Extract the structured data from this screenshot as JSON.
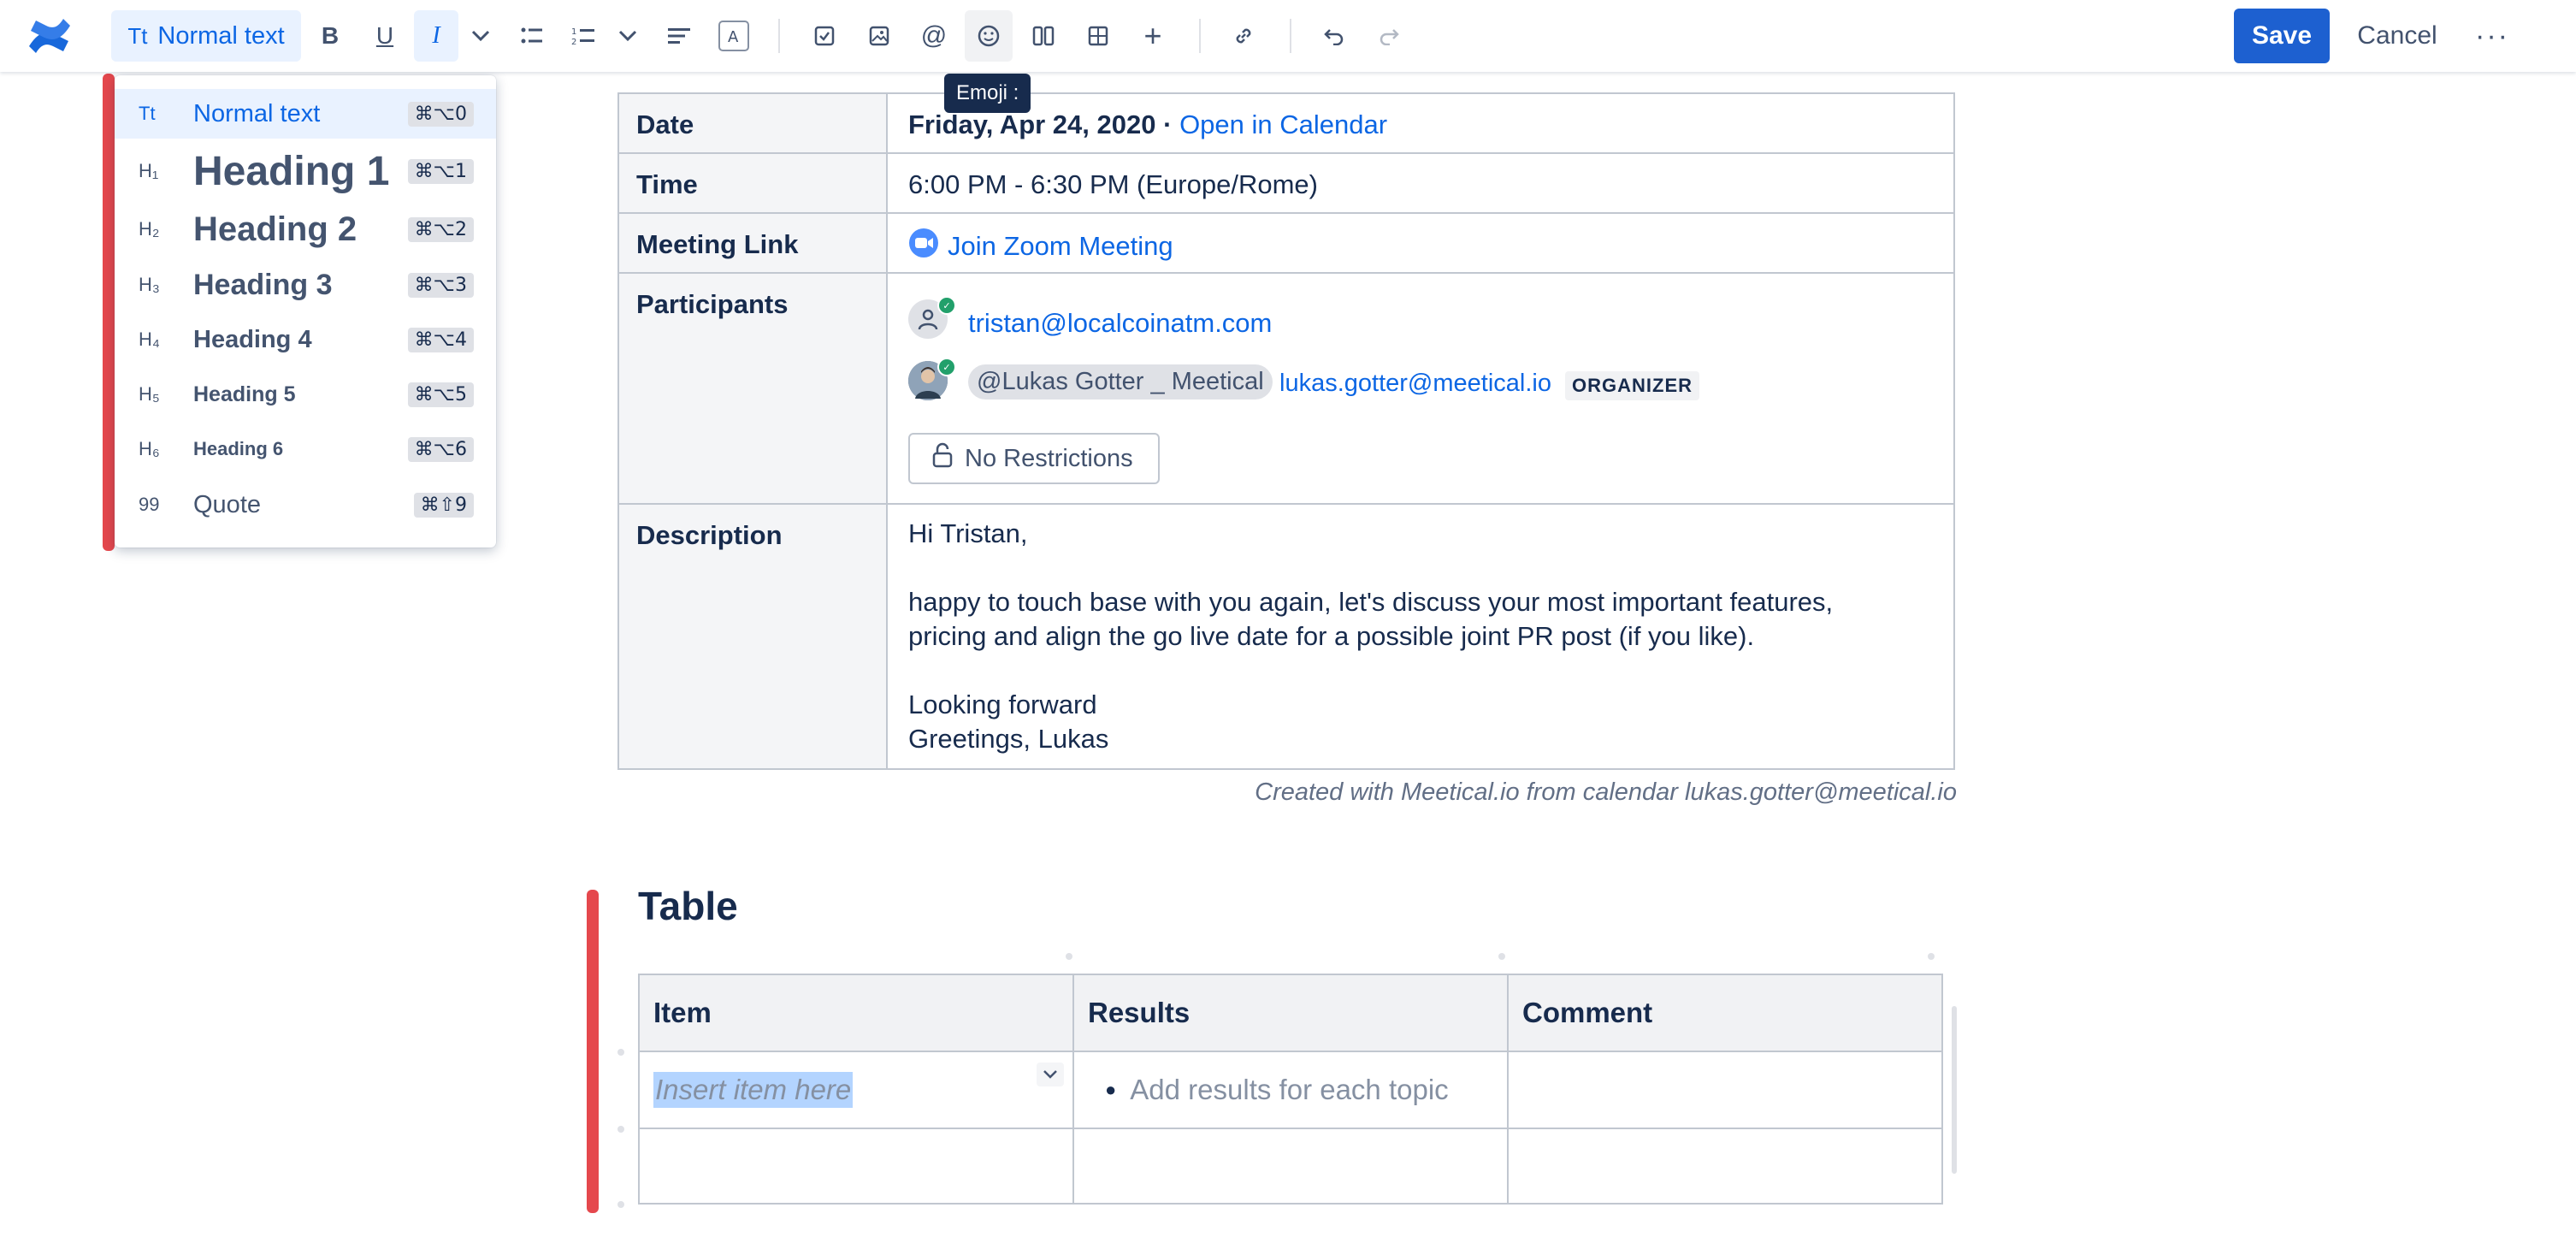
{
  "toolbar": {
    "text_style_label": "Normal text",
    "text_style_icon": "Tt",
    "buttons": [
      "bold-icon",
      "underline-icon",
      "italic-icon",
      "more-formatting-icon",
      "bullet-list-icon",
      "numbered-list-icon",
      "list-dropdown-icon",
      "align-icon",
      "text-color-icon",
      "action-item-icon",
      "image-icon",
      "mention-icon",
      "emoji-icon",
      "layouts-icon",
      "columns-icon",
      "table-icon",
      "insert-icon",
      "link-icon",
      "undo-icon",
      "redo-icon"
    ],
    "save_label": "Save",
    "cancel_label": "Cancel",
    "more_label": "···",
    "tooltip": "Emoji :"
  },
  "text_style_menu": {
    "items": [
      {
        "icon": "Tt",
        "label": "Normal text",
        "shortcut": "⌘⌥0",
        "selected": true
      },
      {
        "icon": "H₁",
        "label": "Heading 1",
        "shortcut": "⌘⌥1"
      },
      {
        "icon": "H₂",
        "label": "Heading 2",
        "shortcut": "⌘⌥2"
      },
      {
        "icon": "H₃",
        "label": "Heading 3",
        "shortcut": "⌘⌥3"
      },
      {
        "icon": "H₄",
        "label": "Heading 4",
        "shortcut": "⌘⌥4"
      },
      {
        "icon": "H₅",
        "label": "Heading 5",
        "shortcut": "⌘⌥5"
      },
      {
        "icon": "H₆",
        "label": "Heading 6",
        "shortcut": "⌘⌥6"
      },
      {
        "icon": "99",
        "label": "Quote",
        "shortcut": "⌘⇧9"
      }
    ]
  },
  "meeting": {
    "date_label": "Date",
    "date_value": "Friday, Apr 24, 2020",
    "date_sep": "·",
    "calendar_link": "Open in Calendar",
    "time_label": "Time",
    "time_value": "6:00 PM - 6:30 PM (Europe/Rome)",
    "link_label": "Meeting Link",
    "zoom_link": "Join Zoom Meeting",
    "participants_label": "Participants",
    "participant1_email": "tristan@localcoinatm.com",
    "participant2_mention": "@Lukas Gotter _ Meetical",
    "participant2_email": "lukas.gotter@meetical.io",
    "participant2_badge": "ORGANIZER",
    "restrictions_label": "No Restrictions",
    "description_label": "Description",
    "description_lines": [
      "Hi Tristan,",
      "",
      "happy to touch base with you again, let's discuss your most important features,",
      "pricing and align the go live date for a possible joint PR post (if you like).",
      "",
      "Looking forward",
      "Greetings, Lukas"
    ],
    "credit": "Created with Meetical.io from calendar lukas.gotter@meetical.io"
  },
  "table_section": {
    "title": "Table",
    "headers": [
      "Item",
      "Results",
      "Comment"
    ],
    "row1_item_placeholder": "Insert item here",
    "row1_results": "Add results for each topic"
  },
  "colors": {
    "accent": "#0c66e4",
    "save_bg": "#1d60d0",
    "marker_red": "#e5484d",
    "header_bg": "#f4f5f7"
  }
}
